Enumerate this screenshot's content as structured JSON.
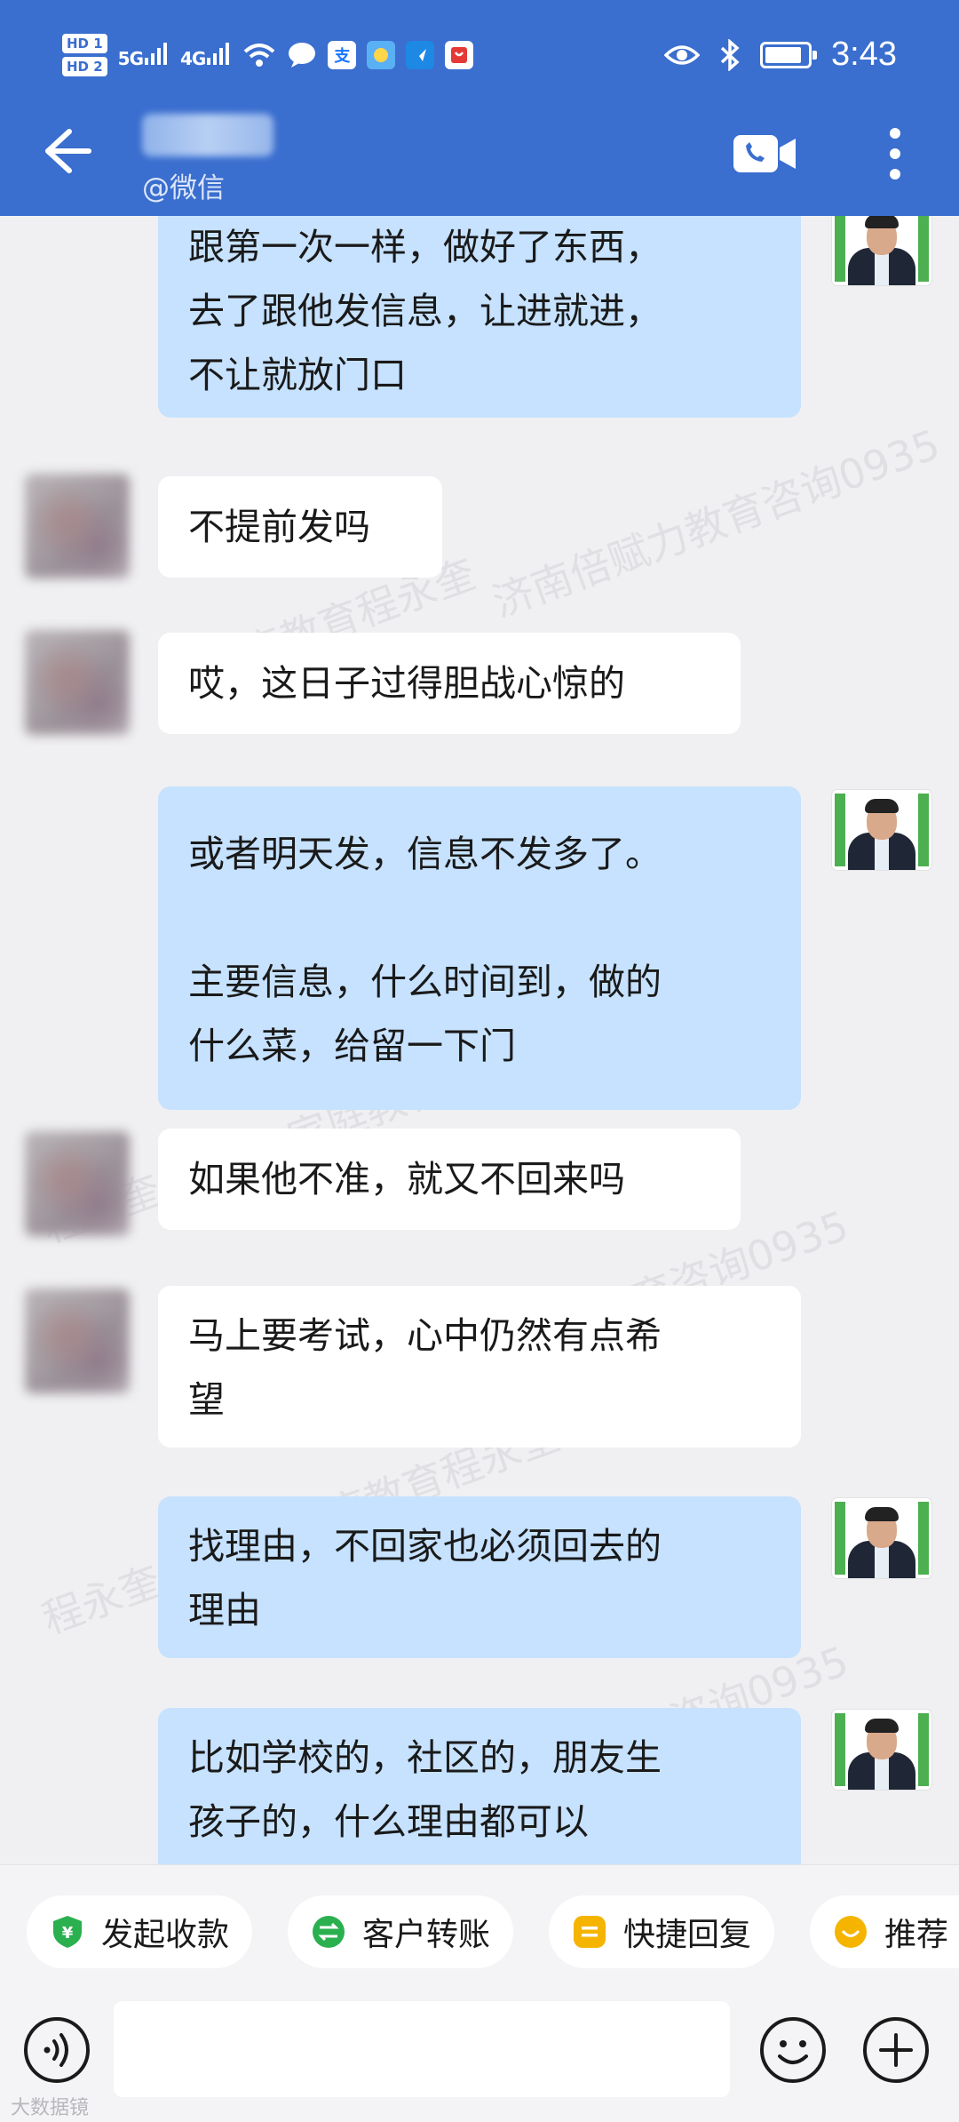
{
  "status_bar": {
    "hd1": "HD 1",
    "hd2": "HD 2",
    "net1": "5G",
    "net2": "4G",
    "time": "3:43"
  },
  "header": {
    "subtitle": "@微信"
  },
  "watermarks": [
    "济南倍赋力教育咨询0935",
    "家庭教育程永奎",
    "程永奎(倍赋力家庭教育程永奎",
    "教育咨询0935"
  ],
  "messages": [
    {
      "side": "out",
      "text": "跟第一次一样，做好了东西，\n去了跟他发信息，让进就进，\n不让就放门口"
    },
    {
      "side": "in",
      "text": "不提前发吗"
    },
    {
      "side": "in",
      "text": "哎，这日子过得胆战心惊的"
    },
    {
      "side": "out",
      "text": "或者明天发，信息不发多了。\n\n主要信息，什么时间到，做的\n什么菜，给留一下门"
    },
    {
      "side": "in",
      "text": "如果他不准，就又不回来吗"
    },
    {
      "side": "in",
      "text": "马上要考试，心中仍然有点希\n望"
    },
    {
      "side": "out",
      "text": "找理由，不回家也必须回去的\n理由"
    },
    {
      "side": "out",
      "text": "比如学校的，社区的，朋友生\n孩子的，什么理由都可以"
    }
  ],
  "quick_actions": [
    {
      "label": "发起收款",
      "icon": "yuan-shield-icon",
      "color": "#2ab04f"
    },
    {
      "label": "客户转账",
      "icon": "transfer-icon",
      "color": "#2ab04f"
    },
    {
      "label": "快捷回复",
      "icon": "quick-reply-icon",
      "color": "#f5b400"
    },
    {
      "label": "推荐",
      "icon": "recommend-icon",
      "color": "#f5b400"
    }
  ],
  "input": {
    "placeholder": ""
  },
  "footer_watermark": "大数据镜",
  "colors": {
    "header": "#3a6ecf",
    "bubble_out": "#c6e2ff",
    "bubble_in": "#ffffff",
    "background": "#f0f0f2"
  }
}
